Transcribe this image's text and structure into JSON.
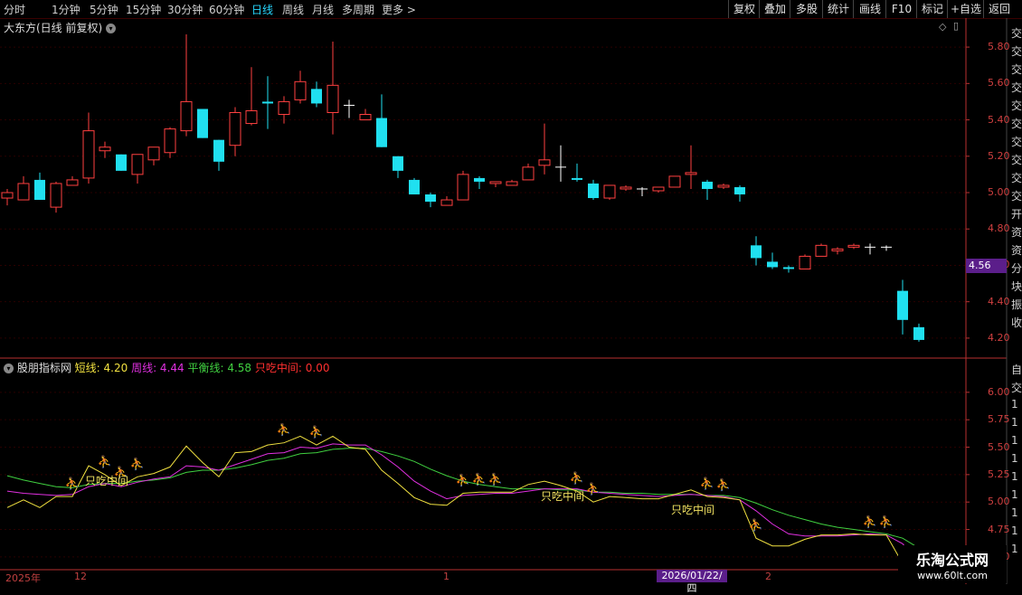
{
  "toolbar": {
    "periods": [
      "分时",
      "1分钟",
      "5分钟",
      "15分钟",
      "30分钟",
      "60分钟",
      "日线",
      "周线",
      "月线",
      "多周期",
      "更多 >"
    ],
    "active_period": "日线",
    "tools": [
      "复权",
      "叠加",
      "多股",
      "统计",
      "画线",
      "F10",
      "标记",
      "+自选",
      "返回"
    ]
  },
  "main_chart": {
    "title": "大东方(日线 前复权)",
    "current_price_tag": "4.56",
    "side_text": [
      "交",
      "交",
      "交",
      "交",
      "交",
      "交",
      "交",
      "交",
      "交",
      "交",
      "开",
      "资",
      "资",
      "分",
      "块",
      "振",
      "收"
    ]
  },
  "indicator": {
    "name": "股朋指标网",
    "values": [
      {
        "label": "短线: 4.20",
        "color": "#f0e040"
      },
      {
        "label": "周线: 4.44",
        "color": "#e030e0"
      },
      {
        "label": "平衡线: 4.58",
        "color": "#40d040"
      },
      {
        "label": "只吃中间: 0.00",
        "color": "#ff3030"
      }
    ],
    "marker_label": "只吃中间",
    "side_text": [
      "自",
      "交",
      "1",
      "1",
      "1",
      "1",
      "1",
      "1",
      "1",
      "1",
      "1"
    ]
  },
  "x_axis": {
    "labels": [
      "2025年",
      "12",
      "1",
      "2"
    ],
    "cursor_date": "2026/01/22/四"
  },
  "watermark": {
    "title": "乐淘公式网",
    "url": "www.60lt.com"
  },
  "chart_data": [
    {
      "type": "candlestick",
      "title": "大东方(日线 前复权)",
      "y_ticks": [
        5.8,
        5.6,
        5.4,
        5.2,
        5.0,
        4.8,
        4.6,
        4.4,
        4.2
      ],
      "ylim": [
        4.12,
        5.88
      ],
      "candles": [
        {
          "o": 4.97,
          "h": 5.02,
          "l": 4.93,
          "c": 5.0
        },
        {
          "o": 4.96,
          "h": 5.09,
          "l": 4.96,
          "c": 5.05
        },
        {
          "o": 5.07,
          "h": 5.11,
          "l": 4.96,
          "c": 4.96
        },
        {
          "o": 4.92,
          "h": 5.06,
          "l": 4.89,
          "c": 5.05
        },
        {
          "o": 5.04,
          "h": 5.09,
          "l": 5.04,
          "c": 5.07
        },
        {
          "o": 5.08,
          "h": 5.44,
          "l": 5.05,
          "c": 5.34
        },
        {
          "o": 5.23,
          "h": 5.28,
          "l": 5.19,
          "c": 5.25
        },
        {
          "o": 5.21,
          "h": 5.21,
          "l": 5.12,
          "c": 5.12
        },
        {
          "o": 5.1,
          "h": 5.21,
          "l": 5.05,
          "c": 5.21
        },
        {
          "o": 5.18,
          "h": 5.25,
          "l": 5.15,
          "c": 5.25
        },
        {
          "o": 5.22,
          "h": 5.36,
          "l": 5.19,
          "c": 5.35
        },
        {
          "o": 5.34,
          "h": 5.87,
          "l": 5.31,
          "c": 5.5
        },
        {
          "o": 5.46,
          "h": 5.46,
          "l": 5.3,
          "c": 5.3
        },
        {
          "o": 5.29,
          "h": 5.29,
          "l": 5.12,
          "c": 5.17
        },
        {
          "o": 5.26,
          "h": 5.47,
          "l": 5.2,
          "c": 5.44
        },
        {
          "o": 5.38,
          "h": 5.69,
          "l": 5.37,
          "c": 5.45
        },
        {
          "o": 5.5,
          "h": 5.64,
          "l": 5.35,
          "c": 5.49
        },
        {
          "o": 5.43,
          "h": 5.53,
          "l": 5.38,
          "c": 5.5
        },
        {
          "o": 5.51,
          "h": 5.67,
          "l": 5.49,
          "c": 5.61
        },
        {
          "o": 5.57,
          "h": 5.61,
          "l": 5.47,
          "c": 5.49
        },
        {
          "o": 5.44,
          "h": 5.83,
          "l": 5.32,
          "c": 5.59
        },
        {
          "o": 5.48,
          "h": 5.51,
          "l": 5.41,
          "c": 5.48
        },
        {
          "o": 5.4,
          "h": 5.46,
          "l": 5.4,
          "c": 5.43
        },
        {
          "o": 5.41,
          "h": 5.54,
          "l": 5.25,
          "c": 5.25
        },
        {
          "o": 5.2,
          "h": 5.2,
          "l": 5.08,
          "c": 5.12
        },
        {
          "o": 5.07,
          "h": 5.08,
          "l": 4.99,
          "c": 4.99
        },
        {
          "o": 4.99,
          "h": 5.0,
          "l": 4.92,
          "c": 4.95
        },
        {
          "o": 4.93,
          "h": 4.98,
          "l": 4.93,
          "c": 4.96
        },
        {
          "o": 4.96,
          "h": 5.12,
          "l": 4.96,
          "c": 5.1
        },
        {
          "o": 5.08,
          "h": 5.09,
          "l": 5.02,
          "c": 5.06
        },
        {
          "o": 5.05,
          "h": 5.06,
          "l": 5.03,
          "c": 5.06
        },
        {
          "o": 5.04,
          "h": 5.07,
          "l": 5.04,
          "c": 5.06
        },
        {
          "o": 5.07,
          "h": 5.16,
          "l": 5.07,
          "c": 5.14
        },
        {
          "o": 5.15,
          "h": 5.38,
          "l": 5.1,
          "c": 5.18
        },
        {
          "o": 5.14,
          "h": 5.26,
          "l": 5.06,
          "c": 5.14
        },
        {
          "o": 5.08,
          "h": 5.16,
          "l": 5.06,
          "c": 5.07
        },
        {
          "o": 5.05,
          "h": 5.07,
          "l": 4.96,
          "c": 4.97
        },
        {
          "o": 4.97,
          "h": 5.04,
          "l": 4.96,
          "c": 5.04
        },
        {
          "o": 5.02,
          "h": 5.04,
          "l": 5.01,
          "c": 5.03
        },
        {
          "o": 5.02,
          "h": 5.03,
          "l": 4.98,
          "c": 5.02
        },
        {
          "o": 5.01,
          "h": 5.03,
          "l": 5.0,
          "c": 5.03
        },
        {
          "o": 5.03,
          "h": 5.09,
          "l": 5.03,
          "c": 5.09
        },
        {
          "o": 5.1,
          "h": 5.26,
          "l": 5.02,
          "c": 5.11
        },
        {
          "o": 5.06,
          "h": 5.07,
          "l": 4.96,
          "c": 5.02
        },
        {
          "o": 5.03,
          "h": 5.05,
          "l": 5.02,
          "c": 5.04
        },
        {
          "o": 5.03,
          "h": 5.04,
          "l": 4.95,
          "c": 4.99
        },
        {
          "o": 4.71,
          "h": 4.76,
          "l": 4.6,
          "c": 4.64
        },
        {
          "o": 4.62,
          "h": 4.67,
          "l": 4.58,
          "c": 4.59
        },
        {
          "o": 4.59,
          "h": 4.6,
          "l": 4.56,
          "c": 4.58
        },
        {
          "o": 4.58,
          "h": 4.66,
          "l": 4.58,
          "c": 4.65
        },
        {
          "o": 4.65,
          "h": 4.72,
          "l": 4.65,
          "c": 4.71
        },
        {
          "o": 4.68,
          "h": 4.7,
          "l": 4.66,
          "c": 4.69
        },
        {
          "o": 4.7,
          "h": 4.72,
          "l": 4.69,
          "c": 4.71
        },
        {
          "o": 4.7,
          "h": 4.72,
          "l": 4.66,
          "c": 4.7
        },
        {
          "o": 4.7,
          "h": 4.71,
          "l": 4.68,
          "c": 4.7
        },
        {
          "o": 4.46,
          "h": 4.52,
          "l": 4.22,
          "c": 4.3
        },
        {
          "o": 4.26,
          "h": 4.28,
          "l": 4.18,
          "c": 4.19
        }
      ]
    },
    {
      "type": "line",
      "title": "股朋指标网",
      "y_ticks": [
        6.0,
        5.75,
        5.5,
        5.25,
        5.0,
        4.75,
        4.5
      ],
      "ylim": [
        4.4,
        6.18
      ],
      "series": [
        {
          "name": "短线",
          "color": "#f0e040",
          "values": [
            4.95,
            5.02,
            4.95,
            5.05,
            5.05,
            5.33,
            5.25,
            5.15,
            5.23,
            5.26,
            5.32,
            5.51,
            5.36,
            5.23,
            5.45,
            5.46,
            5.52,
            5.54,
            5.6,
            5.52,
            5.6,
            5.5,
            5.48,
            5.29,
            5.17,
            5.04,
            4.98,
            4.97,
            5.08,
            5.09,
            5.09,
            5.09,
            5.16,
            5.19,
            5.15,
            5.1,
            5.0,
            5.05,
            5.04,
            5.03,
            5.03,
            5.07,
            5.11,
            5.05,
            5.04,
            5.02,
            4.67,
            4.6,
            4.6,
            4.66,
            4.7,
            4.7,
            4.71,
            4.7,
            4.7,
            4.44,
            4.2
          ]
        },
        {
          "name": "周线",
          "color": "#e030e0",
          "values": [
            5.1,
            5.08,
            5.07,
            5.06,
            5.07,
            5.14,
            5.17,
            5.14,
            5.18,
            5.21,
            5.23,
            5.33,
            5.32,
            5.29,
            5.34,
            5.39,
            5.44,
            5.45,
            5.5,
            5.49,
            5.53,
            5.52,
            5.52,
            5.43,
            5.32,
            5.19,
            5.1,
            5.03,
            5.06,
            5.07,
            5.08,
            5.08,
            5.1,
            5.12,
            5.12,
            5.12,
            5.09,
            5.08,
            5.07,
            5.06,
            5.05,
            5.06,
            5.07,
            5.06,
            5.05,
            5.02,
            4.92,
            4.8,
            4.71,
            4.69,
            4.69,
            4.69,
            4.7,
            4.71,
            4.7,
            4.62,
            4.44
          ]
        },
        {
          "name": "平衡线",
          "color": "#40d040",
          "values": [
            5.24,
            5.2,
            5.17,
            5.14,
            5.13,
            5.16,
            5.17,
            5.17,
            5.19,
            5.2,
            5.22,
            5.27,
            5.29,
            5.29,
            5.31,
            5.34,
            5.38,
            5.4,
            5.44,
            5.45,
            5.48,
            5.49,
            5.49,
            5.46,
            5.42,
            5.37,
            5.3,
            5.24,
            5.19,
            5.16,
            5.14,
            5.12,
            5.12,
            5.12,
            5.11,
            5.11,
            5.09,
            5.09,
            5.08,
            5.08,
            5.07,
            5.07,
            5.07,
            5.06,
            5.06,
            5.04,
            4.99,
            4.93,
            4.88,
            4.84,
            4.8,
            4.77,
            4.75,
            4.73,
            4.71,
            4.67,
            4.58
          ]
        }
      ],
      "signal_markers": [
        4,
        6,
        7,
        8,
        17,
        19,
        28,
        29,
        30,
        35,
        36,
        43,
        44,
        46,
        53,
        54
      ],
      "text_markers": [
        5,
        33,
        41
      ]
    }
  ]
}
